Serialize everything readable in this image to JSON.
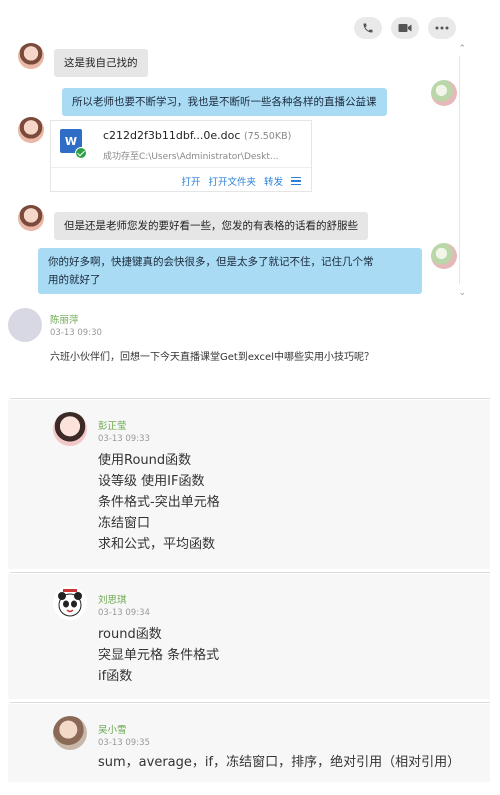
{
  "chat": {
    "actions": [
      {
        "icon": "phone-icon"
      },
      {
        "icon": "video-icon"
      },
      {
        "icon": "more-icon"
      }
    ],
    "messages": [
      {
        "side": "left",
        "text": "这是我自己找的"
      },
      {
        "side": "right",
        "text": "所以老师也要不断学习，我也是不断听一些各种各样的直播公益课"
      },
      {
        "side": "left",
        "file": {
          "name": "c212d2f3b11dbf...0e.doc",
          "size": "(75.50KB)",
          "status": "成功存至C:\\Users\\Administrator\\Deskt...",
          "actions": [
            "打开",
            "打开文件夹",
            "转发"
          ]
        }
      },
      {
        "side": "left",
        "text": "但是还是老师您发的要好看一些，您发的有表格的话看的舒服些"
      },
      {
        "side": "right",
        "text_line1": "你的好多啊，快捷键真的会快很多，但是太多了就记不住，记住几个常",
        "text_line2": "用的就好了"
      }
    ]
  },
  "feed": {
    "post": {
      "author": "陈丽萍",
      "time": "03-13 09:30",
      "text": "六班小伙伴们，回想一下今天直播课堂Get到excel中哪些实用小技巧呢？"
    },
    "replies": [
      {
        "author": "彭正莹",
        "time": "03-13 09:33",
        "lines": [
          "使用Round函数",
          "设等级 使用IF函数",
          "条件格式-突出单元格",
          "冻结窗口",
          "求和公式，平均函数"
        ]
      },
      {
        "author": "刘思琪",
        "time": "03-13 09:34",
        "lines": [
          "round函数",
          "突显单元格  条件格式",
          "if函数"
        ]
      },
      {
        "author": "吴小雪",
        "time": "03-13 09:35",
        "lines": [
          "sum，average，if，冻结窗口，排序，绝对引用（相对引用）"
        ]
      }
    ]
  }
}
